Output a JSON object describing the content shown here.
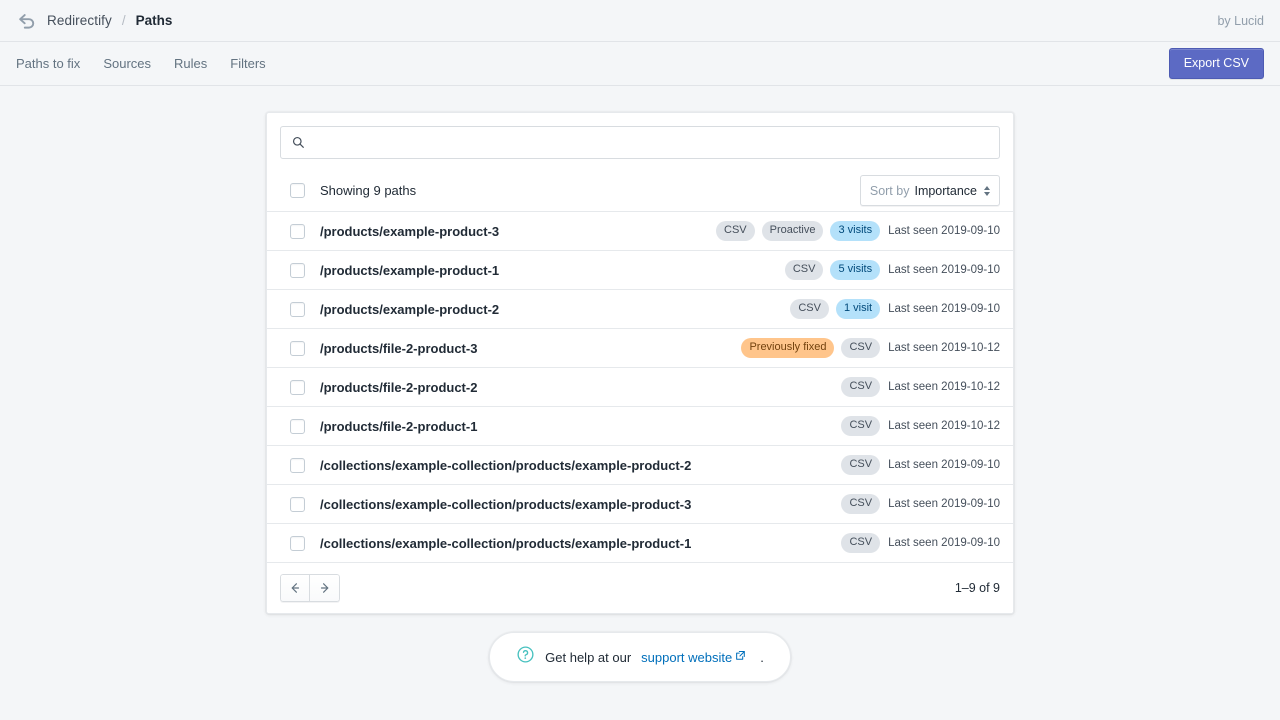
{
  "header": {
    "logo_icon": "redirect-arrow-icon",
    "brand": "Redirectify",
    "separator": "/",
    "current_page": "Paths",
    "byline": "by Lucid"
  },
  "nav": {
    "tabs": [
      {
        "label": "Paths to fix",
        "name": "paths-to-fix"
      },
      {
        "label": "Sources",
        "name": "sources"
      },
      {
        "label": "Rules",
        "name": "rules"
      },
      {
        "label": "Filters",
        "name": "filters"
      }
    ],
    "export_button": "Export CSV"
  },
  "search": {
    "icon": "search-icon",
    "value": "",
    "placeholder": ""
  },
  "list_header": {
    "showing": "Showing 9 paths",
    "sort_label": "Sort by",
    "sort_value": "Importance"
  },
  "rows": [
    {
      "path": "/products/example-product-3",
      "badges": [
        {
          "text": "CSV",
          "tone": "gray"
        },
        {
          "text": "Proactive",
          "tone": "gray"
        },
        {
          "text": "3 visits",
          "tone": "blue"
        }
      ],
      "last_seen": "Last seen 2019-09-10"
    },
    {
      "path": "/products/example-product-1",
      "badges": [
        {
          "text": "CSV",
          "tone": "gray"
        },
        {
          "text": "5 visits",
          "tone": "blue"
        }
      ],
      "last_seen": "Last seen 2019-09-10"
    },
    {
      "path": "/products/example-product-2",
      "badges": [
        {
          "text": "CSV",
          "tone": "gray"
        },
        {
          "text": "1 visit",
          "tone": "blue"
        }
      ],
      "last_seen": "Last seen 2019-09-10"
    },
    {
      "path": "/products/file-2-product-3",
      "badges": [
        {
          "text": "Previously fixed",
          "tone": "orange"
        },
        {
          "text": "CSV",
          "tone": "gray"
        }
      ],
      "last_seen": "Last seen 2019-10-12"
    },
    {
      "path": "/products/file-2-product-2",
      "badges": [
        {
          "text": "CSV",
          "tone": "gray"
        }
      ],
      "last_seen": "Last seen 2019-10-12"
    },
    {
      "path": "/products/file-2-product-1",
      "badges": [
        {
          "text": "CSV",
          "tone": "gray"
        }
      ],
      "last_seen": "Last seen 2019-10-12"
    },
    {
      "path": "/collections/example-collection/products/example-product-2",
      "badges": [
        {
          "text": "CSV",
          "tone": "gray"
        }
      ],
      "last_seen": "Last seen 2019-09-10"
    },
    {
      "path": "/collections/example-collection/products/example-product-3",
      "badges": [
        {
          "text": "CSV",
          "tone": "gray"
        }
      ],
      "last_seen": "Last seen 2019-09-10"
    },
    {
      "path": "/collections/example-collection/products/example-product-1",
      "badges": [
        {
          "text": "CSV",
          "tone": "gray"
        }
      ],
      "last_seen": "Last seen 2019-09-10"
    }
  ],
  "pagination": {
    "prev_icon": "arrow-left-icon",
    "next_icon": "arrow-right-icon",
    "range": "1–9 of 9"
  },
  "help": {
    "icon": "question-circle-icon",
    "text": "Get help at our",
    "link": "support website",
    "external_icon": "external-link-icon",
    "period": "."
  },
  "colors": {
    "page_bg": "#f4f6f8",
    "card_bg": "#ffffff",
    "accent": "#5c6ac4",
    "badge_gray_bg": "#dfe3e8",
    "badge_blue_bg": "#b4e1fa",
    "badge_orange_bg": "#ffc58b",
    "link": "#006fbb",
    "help_icon": "#47c1bf",
    "text": "#212b36",
    "text_subdued": "#637381"
  }
}
